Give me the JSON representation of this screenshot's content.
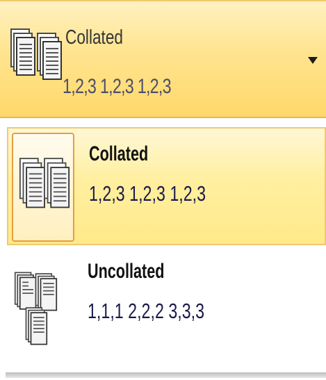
{
  "dropdown": {
    "title": "Collated",
    "subtitle": "1,2,3  1,2,3  1,2,3",
    "icon": "collated-pages-icon",
    "arrow_icon": "dropdown-arrow-icon"
  },
  "options": [
    {
      "title": "Collated",
      "subtitle": "1,2,3   1,2,3   1,2,3",
      "icon": "collated-pages-icon",
      "selected": true
    },
    {
      "title": "Uncollated",
      "subtitle": "1,1,1   2,2,2   3,3,3",
      "icon": "uncollated-pages-icon",
      "selected": false
    }
  ],
  "colors": {
    "highlight": "#ffe48f",
    "highlight_border": "#e49e41",
    "text_dark": "#111111",
    "text_sub": "#1a1a4a"
  }
}
